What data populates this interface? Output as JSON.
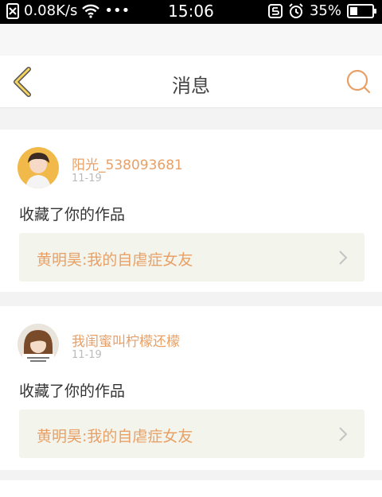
{
  "status_bar": {
    "speed": "0.08K/s",
    "more": "•••",
    "time": "15:06",
    "battery_percent": "35%",
    "battery_level": 0.35
  },
  "header": {
    "title": "消息",
    "back_icon": "chevron-left-icon",
    "search_icon": "search-icon",
    "accent_color": "#e8a066"
  },
  "messages": [
    {
      "username": "阳光_538093681",
      "date": "11-19",
      "action": "收藏了你的作品",
      "work_title": "黄明昊:我的自虐症女友"
    },
    {
      "username": "我闺蜜叫柠檬还檬",
      "date": "11-19",
      "action": "收藏了你的作品",
      "work_title": "黄明昊:我的自虐症女友"
    }
  ]
}
